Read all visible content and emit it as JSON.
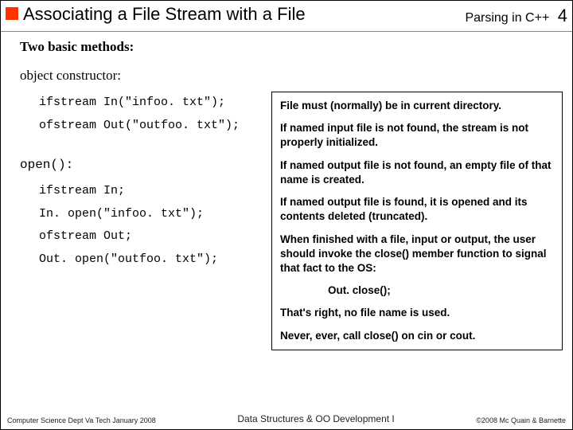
{
  "header": {
    "title": "Associating a File Stream with a File",
    "rightLabel": "Parsing in C++",
    "pageNumber": "4"
  },
  "body": {
    "twoBasic": "Two basic methods:",
    "objectConstructor": "object constructor:",
    "code1a": "ifstream In(\"infoo. txt\");",
    "code1b": "ofstream Out(\"outfoo. txt\");",
    "openLabel": "open():",
    "code2a": "ifstream In;",
    "code2b": "In. open(\"infoo. txt\");",
    "code2c": "ofstream Out;",
    "code2d": "Out. open(\"outfoo. txt\");"
  },
  "box": {
    "p1": "File must (normally) be in current directory.",
    "p2": "If named input file is not found, the stream is not properly initialized.",
    "p3": "If named output file is not found, an empty file of that name is created.",
    "p4": "If named output file is found, it is opened and its contents deleted (truncated).",
    "p5": "When finished with a file, input or output, the user should invoke the close() member function to signal that fact to the OS:",
    "p6": "Out. close();",
    "p7": "That's right, no file name is used.",
    "p8": "Never, ever, call close() on cin or cout."
  },
  "footer": {
    "left": "Computer Science Dept Va Tech January 2008",
    "mid": "Data Structures & OO Development I",
    "right": "©2008 Mc Quain & Barnette"
  }
}
